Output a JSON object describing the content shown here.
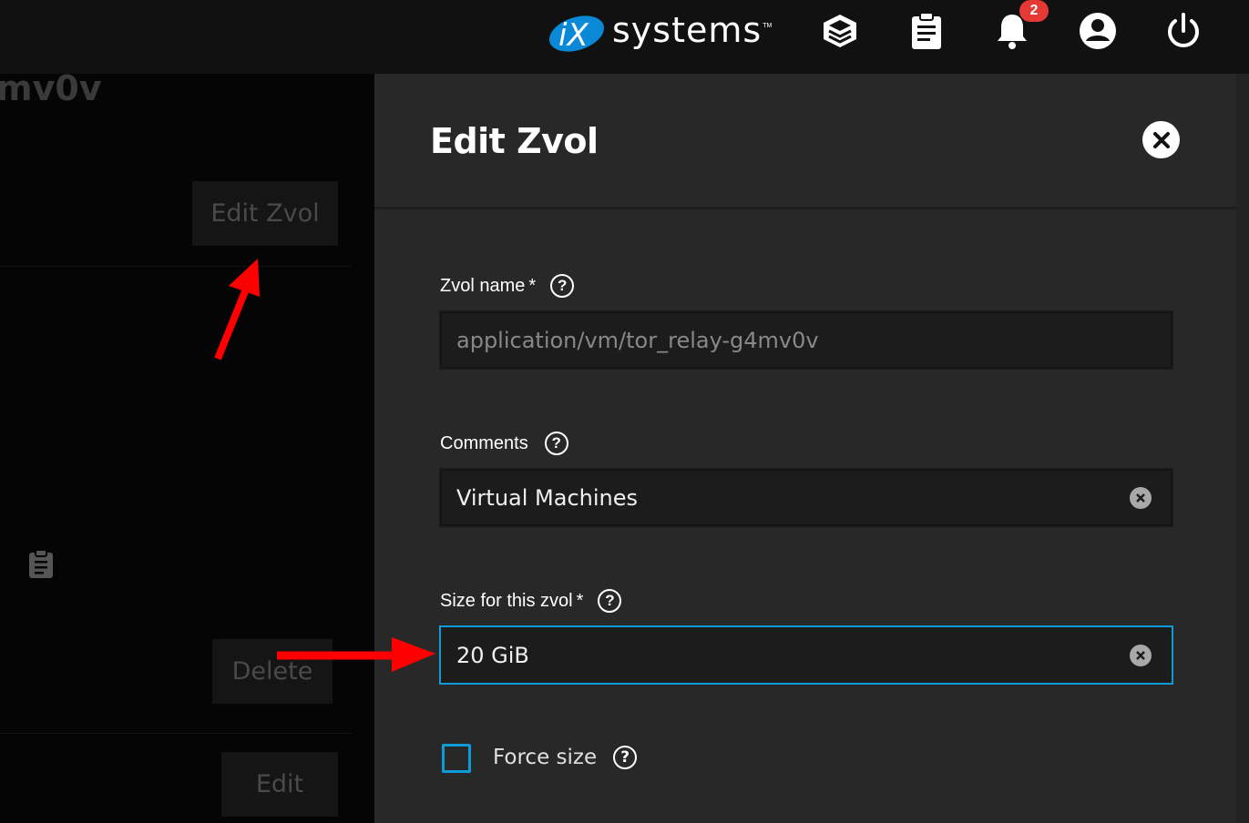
{
  "topbar": {
    "brand": "systems",
    "brand_mark": "iX",
    "brand_tm": "TM",
    "icons": [
      "truecommand-icon",
      "clipboard-icon",
      "bell-icon",
      "account-icon",
      "power-icon"
    ],
    "notification_count": "2"
  },
  "background_page": {
    "title_fragment": "mv0v",
    "edit_zvol_label": "Edit Zvol",
    "delete_label": "Delete",
    "edit_label": "Edit"
  },
  "panel": {
    "title": "Edit Zvol",
    "fields": {
      "zvol_name": {
        "label": "Zvol name",
        "required_mark": "*",
        "value": "application/vm/tor_relay-g4mv0v"
      },
      "comments": {
        "label": "Comments",
        "value": "Virtual Machines"
      },
      "size": {
        "label": "Size for this zvol",
        "required_mark": "*",
        "value": "20 GiB"
      }
    },
    "force_size": {
      "label": "Force size",
      "checked": false
    },
    "help_glyph": "?"
  },
  "colors": {
    "accent": "#0f9bd7",
    "annotation_arrow": "#ff0000",
    "badge": "#e53935",
    "panel_bg": "#282828"
  }
}
